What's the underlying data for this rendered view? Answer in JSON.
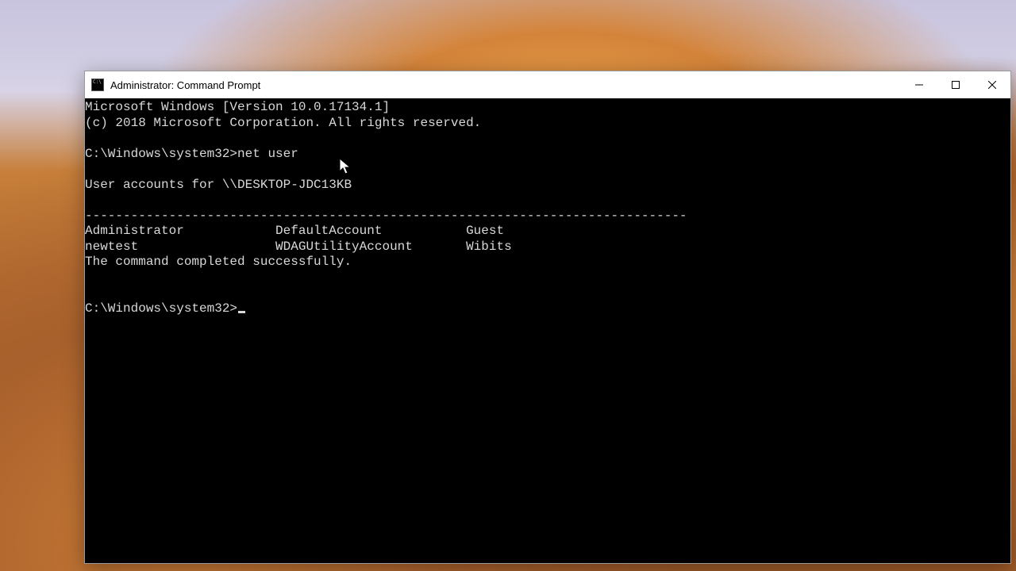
{
  "window": {
    "title": "Administrator: Command Prompt"
  },
  "controls": {
    "minimize": "Minimize",
    "maximize": "Maximize",
    "close": "Close"
  },
  "terminal": {
    "line_version": "Microsoft Windows [Version 10.0.17134.1]",
    "line_copyright": "(c) 2018 Microsoft Corporation. All rights reserved.",
    "prompt1": "C:\\Windows\\system32>",
    "command1": "net user",
    "blank": "",
    "accounts_header": "User accounts for \\\\DESKTOP-JDC13KB",
    "divider": "-------------------------------------------------------------------------------",
    "row1": "Administrator            DefaultAccount           Guest",
    "row2": "newtest                  WDAGUtilityAccount       Wibits",
    "completed": "The command completed successfully.",
    "prompt2": "C:\\Windows\\system32>"
  }
}
